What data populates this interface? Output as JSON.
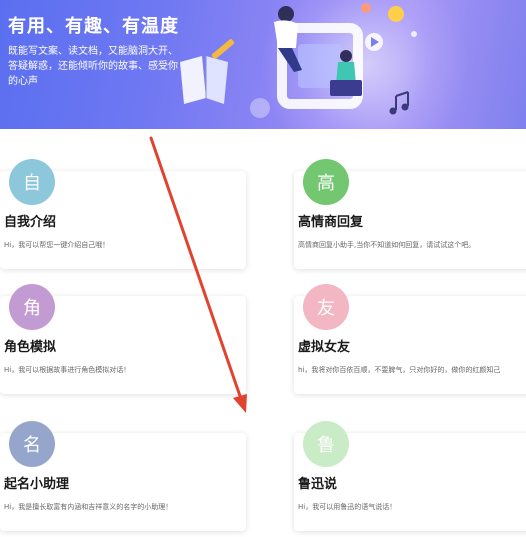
{
  "banner": {
    "title": "有用、有趣、有温度",
    "description": "既能写文案、读文档，又能脑洞大开、答疑解惑，还能倾听你的故事、感受你的心声"
  },
  "cards": [
    {
      "title": "自我介绍",
      "avatar_char": "自",
      "avatar_color": "#8cc7dc",
      "description": "Hi，我可以帮您一键介绍自己哦！"
    },
    {
      "title": "高情商回复",
      "avatar_char": "高",
      "avatar_color": "#73c771",
      "description": "高情商回复小助手,当你不知道如何回复，请试试这个吧。"
    },
    {
      "title": "角色模拟",
      "avatar_char": "角",
      "avatar_color": "#c39bd3",
      "description": "Hi，我可以根据故事进行角色模拟对话！"
    },
    {
      "title": "虚拟女友",
      "avatar_char": "友",
      "avatar_color": "#f3b6c3",
      "description": "hi，我将对你百依百顺，不耍脾气，只对你好的，做你的红颜知己"
    },
    {
      "title": "起名小助理",
      "avatar_char": "名",
      "avatar_color": "#95a5cc",
      "description": "Hi，我是擅长取富有内涵和吉祥意义的名字的小助理！"
    },
    {
      "title": "鲁迅说",
      "avatar_char": "鲁",
      "avatar_color": "#c9ecc7",
      "description": "Hi，我可以用鲁迅的语气说话！"
    }
  ],
  "colors": {
    "annotation_arrow": "#e2432f",
    "banner_start": "#5a6ff0",
    "banner_end": "#a897f6"
  }
}
